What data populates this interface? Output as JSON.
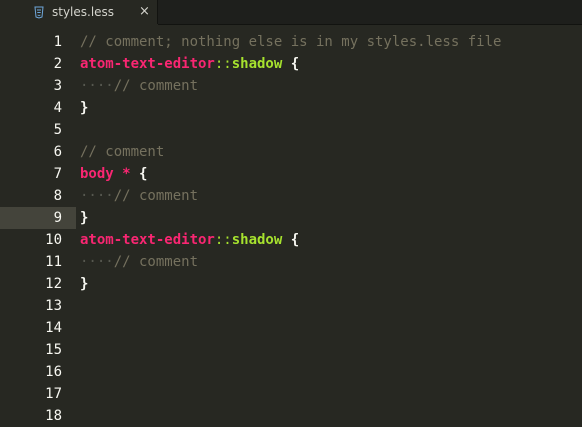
{
  "tab": {
    "title": "styles.less",
    "close": "×",
    "icon": "css-file-icon"
  },
  "editor": {
    "current_line": 9,
    "line_numbers": [
      "1",
      "2",
      "3",
      "4",
      "5",
      "6",
      "7",
      "8",
      "9",
      "10",
      "11",
      "12",
      "13",
      "14",
      "15",
      "16",
      "17",
      "18"
    ],
    "lines": [
      {
        "tokens": [
          {
            "t": "// comment; nothing else is in my styles.less file",
            "c": "comment"
          }
        ]
      },
      {
        "tokens": [
          {
            "t": "atom-text-editor",
            "c": "selector"
          },
          {
            "t": "::",
            "c": "pseudo-punct"
          },
          {
            "t": "shadow",
            "c": "pseudo"
          },
          {
            "t": " {",
            "c": "brace"
          }
        ]
      },
      {
        "tokens": [
          {
            "t": "····",
            "c": "indent"
          },
          {
            "t": "// comment",
            "c": "comment"
          }
        ]
      },
      {
        "tokens": [
          {
            "t": "}",
            "c": "brace"
          }
        ]
      },
      {
        "tokens": []
      },
      {
        "tokens": [
          {
            "t": "// comment",
            "c": "comment"
          }
        ]
      },
      {
        "tokens": [
          {
            "t": "body",
            "c": "selector"
          },
          {
            "t": " ",
            "c": "plain"
          },
          {
            "t": "*",
            "c": "star"
          },
          {
            "t": " {",
            "c": "brace"
          }
        ]
      },
      {
        "tokens": [
          {
            "t": "····",
            "c": "indent"
          },
          {
            "t": "// comment",
            "c": "comment"
          }
        ]
      },
      {
        "tokens": [
          {
            "t": "}",
            "c": "brace"
          }
        ]
      },
      {
        "tokens": [
          {
            "t": "atom-text-editor",
            "c": "selector"
          },
          {
            "t": "::",
            "c": "pseudo-punct"
          },
          {
            "t": "shadow",
            "c": "pseudo"
          },
          {
            "t": " {",
            "c": "brace"
          }
        ]
      },
      {
        "tokens": [
          {
            "t": "····",
            "c": "indent"
          },
          {
            "t": "// comment",
            "c": "comment"
          }
        ]
      },
      {
        "tokens": [
          {
            "t": "}",
            "c": "brace"
          }
        ]
      },
      {
        "tokens": []
      },
      {
        "tokens": []
      },
      {
        "tokens": []
      },
      {
        "tokens": []
      },
      {
        "tokens": []
      },
      {
        "tokens": []
      }
    ]
  },
  "colors": {
    "background": "#272822",
    "comment": "#75715e",
    "selector": "#f92672",
    "pseudo": "#a6e22e",
    "text": "#f8f8f2",
    "cursor_line": "#44443b"
  }
}
